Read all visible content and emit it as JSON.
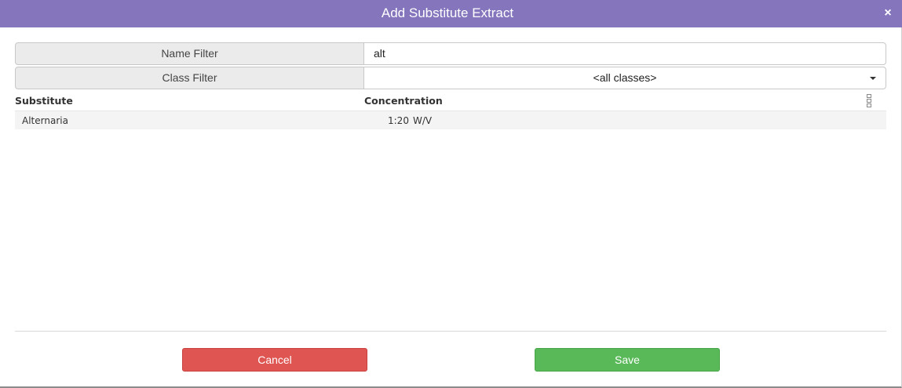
{
  "dialog": {
    "title": "Add Substitute Extract",
    "close_label": "×"
  },
  "filters": {
    "name_label": "Name Filter",
    "name_value": "alt",
    "class_label": "Class Filter",
    "class_value": "<all classes>"
  },
  "grid": {
    "columns": [
      "Substitute",
      "Concentration"
    ],
    "rows": [
      {
        "substitute": "Alternaria",
        "concentration": "1:20",
        "unit": "W/V"
      }
    ]
  },
  "footer": {
    "cancel_label": "Cancel",
    "save_label": "Save"
  },
  "colors": {
    "titlebar": "#8475bd",
    "cancel": "#de5552",
    "save": "#59b959"
  },
  "icons": {
    "close": "close-icon",
    "dropdown": "chevron-down-icon",
    "column_menu": "column-menu-icon"
  }
}
